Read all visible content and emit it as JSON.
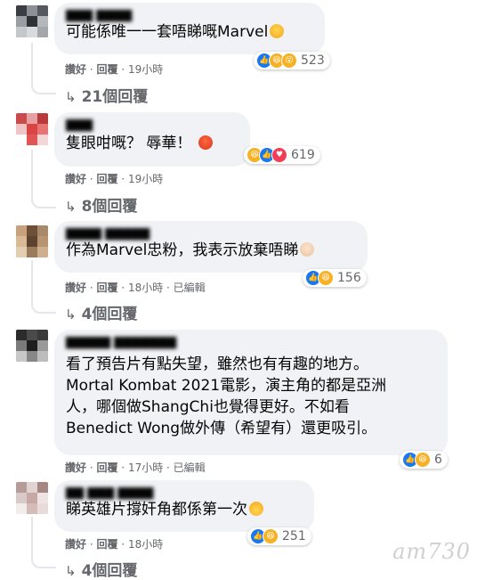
{
  "comments": [
    {
      "text": "可能係唯一一套唔睇嘅Marvel",
      "actions": {
        "like": "讚好",
        "reply": "回覆",
        "time": "19小時"
      },
      "reactions": {
        "icons": [
          "like-icon",
          "haha-icon",
          "wow-icon"
        ],
        "count": "523"
      },
      "replies_label": "21個回覆"
    },
    {
      "text": "隻眼咁嘅？ 辱華！",
      "actions": {
        "like": "讚好",
        "reply": "回覆",
        "time": "19小時"
      },
      "reactions": {
        "icons": [
          "haha-icon",
          "like-icon",
          "love-icon"
        ],
        "count": "619"
      },
      "replies_label": "8個回覆"
    },
    {
      "text": "作為Marvel忠粉，我表示放棄唔睇",
      "actions": {
        "like": "讚好",
        "reply": "回覆",
        "time": "18小時",
        "edited": "已編輯"
      },
      "reactions": {
        "icons": [
          "like-icon",
          "haha-icon"
        ],
        "count": "156"
      },
      "replies_label": "4個回覆"
    },
    {
      "text": "看了預告片有點失望，雖然也有有趣的地方。Mortal Kombat 2021電影，演主角的都是亞洲人，哪個做ShangChi也覺得更好。不如看Benedict Wong做外傳（希望有）還更吸引。",
      "lines": [
        "看了預告片有點失望，雖然也有有趣的地方。",
        "Mortal Kombat 2021電影，演主角的都是亞洲",
        "人，哪個做ShangChi也覺得更好。不如看",
        "Benedict Wong做外傳（希望有）還更吸引。"
      ],
      "actions": {
        "like": "讚好",
        "reply": "回覆",
        "time": "17小時",
        "edited": "已編輯"
      },
      "reactions": {
        "icons": [
          "like-icon",
          "haha-icon"
        ],
        "count": "6"
      }
    },
    {
      "text": "睇英雄片撐奸角都係第一次",
      "actions": {
        "like": "讚好",
        "reply": "回覆",
        "time": "18小時"
      },
      "reactions": {
        "icons": [
          "like-icon",
          "haha-icon"
        ],
        "count": "251"
      },
      "replies_label": "4個回覆"
    }
  ],
  "watermark": "am730",
  "colors": {
    "bubble": "#f0f2f5",
    "meta": "#65676b",
    "like": "#1877f2",
    "haha": "#f7b125",
    "love": "#f33e58"
  }
}
